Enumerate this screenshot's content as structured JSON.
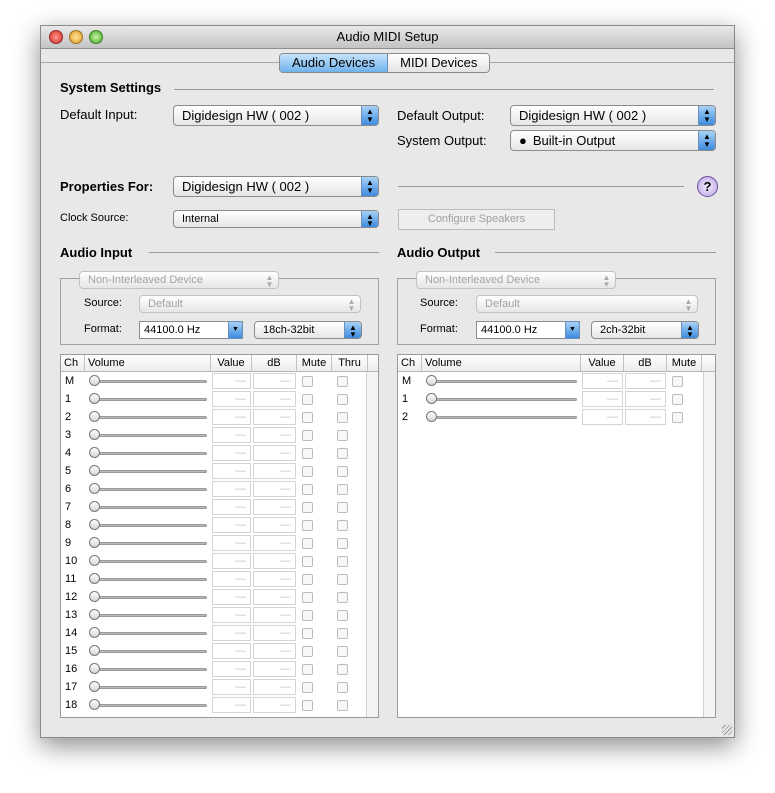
{
  "window": {
    "title": "Audio MIDI Setup"
  },
  "tabs": [
    {
      "label": "Audio Devices",
      "selected": true
    },
    {
      "label": "MIDI Devices",
      "selected": false
    }
  ],
  "system_settings": {
    "heading": "System Settings",
    "default_input_label": "Default Input:",
    "default_input": "Digidesign HW ( 002 )",
    "default_output_label": "Default Output:",
    "default_output": "Digidesign HW ( 002 )",
    "system_output_label": "System Output:",
    "system_output": "Built-in Output",
    "system_output_icon": "apple-icon"
  },
  "properties": {
    "label": "Properties For:",
    "device": "Digidesign HW ( 002 )",
    "clock_source_label": "Clock Source:",
    "clock_source": "Internal",
    "configure_speakers": "Configure Speakers",
    "help": "?"
  },
  "audio_input": {
    "heading": "Audio Input",
    "mode": "Non-Interleaved Device",
    "source_label": "Source:",
    "source": "Default",
    "format_label": "Format:",
    "rate": "44100.0 Hz",
    "format": "18ch-32bit",
    "columns": [
      "Ch",
      "Volume",
      "Value",
      "dB",
      "Mute",
      "Thru"
    ],
    "channels": [
      "M",
      "1",
      "2",
      "3",
      "4",
      "5",
      "6",
      "7",
      "8",
      "9",
      "10",
      "11",
      "12",
      "13",
      "14",
      "15",
      "16",
      "17",
      "18"
    ],
    "empty_value": "—"
  },
  "audio_output": {
    "heading": "Audio Output",
    "mode": "Non-Interleaved Device",
    "source_label": "Source:",
    "source": "Default",
    "format_label": "Format:",
    "rate": "44100.0 Hz",
    "format": "2ch-32bit",
    "columns": [
      "Ch",
      "Volume",
      "Value",
      "dB",
      "Mute"
    ],
    "channels": [
      "M",
      "1",
      "2"
    ],
    "empty_value": "—"
  },
  "colors": {
    "accent": "#5ea6ea",
    "close": "#e2423a",
    "minimize": "#f0b030",
    "zoom": "#5cc43a"
  }
}
